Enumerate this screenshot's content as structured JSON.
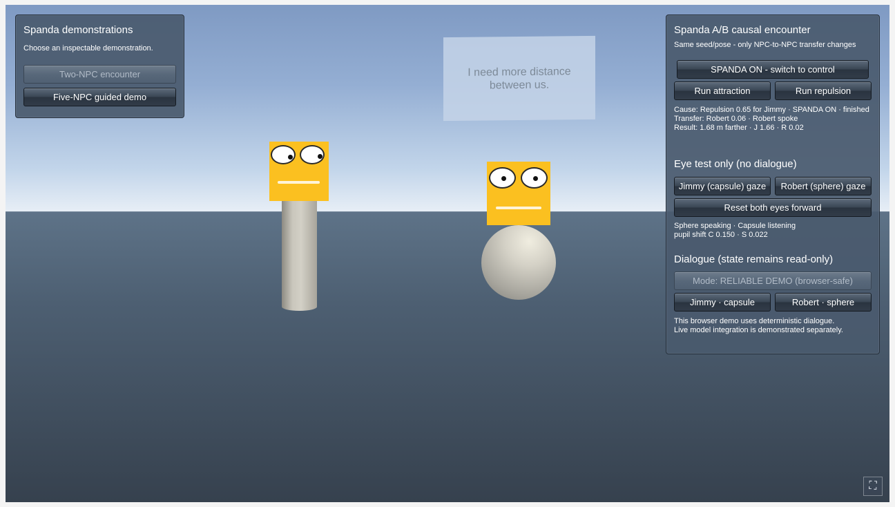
{
  "left_panel": {
    "title": "Spanda demonstrations",
    "subtitle": "Choose an inspectable demonstration.",
    "buttons": {
      "two_npc": "Two-NPC encounter",
      "five_npc": "Five-NPC guided demo"
    }
  },
  "right_panel": {
    "title": "Spanda A/B causal encounter",
    "subtitle": "Same seed/pose - only NPC-to-NPC transfer changes",
    "toggle_button": "SPANDA ON - switch to control",
    "run_attraction": "Run attraction",
    "run_repulsion": "Run repulsion",
    "status": [
      "Cause: Repulsion 0.65 for Jimmy · SPANDA ON · finished",
      "Transfer: Robert 0.06 · Robert spoke",
      "Result: 1.68 m farther · J 1.66 · R 0.02"
    ],
    "eye_test": {
      "heading": "Eye test only (no dialogue)",
      "jimmy_gaze": "Jimmy (capsule) gaze",
      "robert_gaze": "Robert (sphere) gaze",
      "reset": "Reset both eyes forward",
      "info": [
        "Sphere speaking · Capsule listening",
        "pupil shift C 0.150 · S 0.022"
      ]
    },
    "dialogue": {
      "heading": "Dialogue (state remains read-only)",
      "mode": "Mode: RELIABLE DEMO (browser-safe)",
      "jimmy": "Jimmy · capsule",
      "robert": "Robert · sphere",
      "note": [
        "This browser demo uses deterministic dialogue.",
        "Live model integration is demonstrated separately."
      ]
    }
  },
  "scene": {
    "speech_bubble": [
      "I need more distance",
      "between us."
    ],
    "npc_colors": {
      "head": "#fbc020",
      "body": "#cfccc3"
    }
  },
  "icons": {
    "fullscreen": "fullscreen-icon"
  }
}
